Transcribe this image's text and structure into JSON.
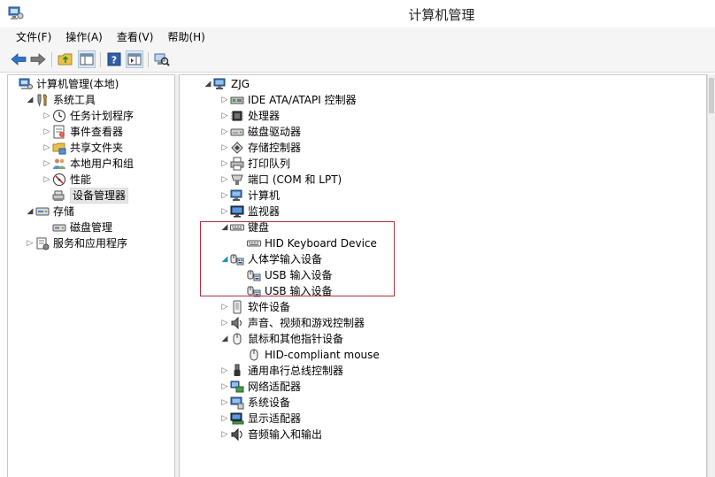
{
  "window": {
    "title": "计算机管理"
  },
  "menu": [
    "文件(F)",
    "操作(A)",
    "查看(V)",
    "帮助(H)"
  ],
  "toolbar": [
    {
      "name": "back-arrow-icon"
    },
    {
      "name": "forward-arrow-icon"
    },
    {
      "name": "folder-up-icon"
    },
    {
      "name": "show-hide-tree-icon"
    },
    {
      "name": "help-icon"
    },
    {
      "name": "action-pane-icon"
    },
    {
      "name": "scan-hardware-icon"
    }
  ],
  "left_tree": [
    {
      "label": "计算机管理(本地)",
      "depth": 0,
      "expander": "",
      "icon": "computer-management-icon"
    },
    {
      "label": "系统工具",
      "depth": 1,
      "expander": "open",
      "icon": "system-tools-icon"
    },
    {
      "label": "任务计划程序",
      "depth": 2,
      "expander": "closed",
      "icon": "task-scheduler-icon"
    },
    {
      "label": "事件查看器",
      "depth": 2,
      "expander": "closed",
      "icon": "event-viewer-icon"
    },
    {
      "label": "共享文件夹",
      "depth": 2,
      "expander": "closed",
      "icon": "shared-folders-icon"
    },
    {
      "label": "本地用户和组",
      "depth": 2,
      "expander": "closed",
      "icon": "local-users-icon"
    },
    {
      "label": "性能",
      "depth": 2,
      "expander": "closed",
      "icon": "performance-icon"
    },
    {
      "label": "设备管理器",
      "depth": 2,
      "expander": "",
      "icon": "device-manager-icon",
      "selected": true
    },
    {
      "label": "存储",
      "depth": 1,
      "expander": "open",
      "icon": "storage-icon"
    },
    {
      "label": "磁盘管理",
      "depth": 2,
      "expander": "",
      "icon": "disk-management-icon"
    },
    {
      "label": "服务和应用程序",
      "depth": 1,
      "expander": "closed",
      "icon": "services-apps-icon"
    }
  ],
  "device_tree": [
    {
      "label": "ZJG",
      "depth": 0,
      "expander": "open",
      "icon": "computer-icon"
    },
    {
      "label": "IDE ATA/ATAPI 控制器",
      "depth": 1,
      "expander": "closed",
      "icon": "ide-controller-icon"
    },
    {
      "label": "处理器",
      "depth": 1,
      "expander": "closed",
      "icon": "processor-icon"
    },
    {
      "label": "磁盘驱动器",
      "depth": 1,
      "expander": "closed",
      "icon": "disk-drive-icon"
    },
    {
      "label": "存储控制器",
      "depth": 1,
      "expander": "closed",
      "icon": "storage-controller-icon"
    },
    {
      "label": "打印队列",
      "depth": 1,
      "expander": "closed",
      "icon": "printer-icon"
    },
    {
      "label": "端口 (COM 和 LPT)",
      "depth": 1,
      "expander": "closed",
      "icon": "port-icon"
    },
    {
      "label": "计算机",
      "depth": 1,
      "expander": "closed",
      "icon": "computer-icon"
    },
    {
      "label": "监视器",
      "depth": 1,
      "expander": "closed",
      "icon": "monitor-icon"
    },
    {
      "label": "键盘",
      "depth": 1,
      "expander": "open",
      "icon": "keyboard-icon"
    },
    {
      "label": "HID Keyboard Device",
      "depth": 2,
      "expander": "",
      "icon": "keyboard-icon"
    },
    {
      "label": "人体学输入设备",
      "depth": 1,
      "expander": "open-blue",
      "icon": "hid-icon"
    },
    {
      "label": "USB 输入设备",
      "depth": 2,
      "expander": "",
      "icon": "hid-icon"
    },
    {
      "label": "USB 输入设备",
      "depth": 2,
      "expander": "",
      "icon": "hid-icon"
    },
    {
      "label": "软件设备",
      "depth": 1,
      "expander": "closed",
      "icon": "software-device-icon"
    },
    {
      "label": "声音、视频和游戏控制器",
      "depth": 1,
      "expander": "closed",
      "icon": "sound-icon"
    },
    {
      "label": "鼠标和其他指针设备",
      "depth": 1,
      "expander": "open",
      "icon": "mouse-icon"
    },
    {
      "label": "HID-compliant mouse",
      "depth": 2,
      "expander": "",
      "icon": "mouse-icon"
    },
    {
      "label": "通用串行总线控制器",
      "depth": 1,
      "expander": "closed",
      "icon": "usb-icon"
    },
    {
      "label": "网络适配器",
      "depth": 1,
      "expander": "closed",
      "icon": "network-adapter-icon"
    },
    {
      "label": "系统设备",
      "depth": 1,
      "expander": "closed",
      "icon": "system-device-icon"
    },
    {
      "label": "显示适配器",
      "depth": 1,
      "expander": "closed",
      "icon": "display-adapter-icon"
    },
    {
      "label": "音频输入和输出",
      "depth": 1,
      "expander": "closed",
      "icon": "audio-io-icon"
    }
  ],
  "colors": {
    "highlight_box": "#b03040",
    "accent": "#1e90c8"
  }
}
